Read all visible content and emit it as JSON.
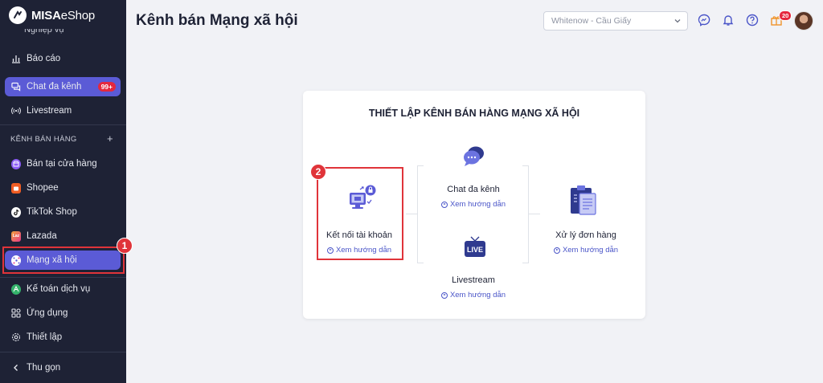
{
  "brand": {
    "name_bold": "MISA",
    "name_light": "eShop"
  },
  "sidebar": {
    "cut_item": "Nghiệp vụ",
    "items": [
      {
        "label": "Báo cáo",
        "icon": "bar-chart-icon"
      },
      {
        "label": "Chat đa kênh",
        "icon": "chat-icon",
        "badge": "99+"
      },
      {
        "label": "Livestream",
        "icon": "broadcast-icon"
      }
    ],
    "section_label": "KÊNH BÁN HÀNG",
    "section_add": "+",
    "channels": [
      {
        "label": "Bán tại cửa hàng",
        "color": "#8b5cf6"
      },
      {
        "label": "Shopee",
        "color": "#f05d23"
      },
      {
        "label": "TikTok Shop",
        "color": "#111111"
      },
      {
        "label": "Lazada",
        "color": "#e53a8a"
      },
      {
        "label": "Mạng xã hội",
        "color": "#ffffff"
      }
    ],
    "bottom_items": [
      {
        "label": "Kế toán dịch vụ",
        "icon": "accounting-icon"
      },
      {
        "label": "Ứng dụng",
        "icon": "apps-icon"
      },
      {
        "label": "Thiết lập",
        "icon": "settings-icon"
      }
    ],
    "collapse_label": "Thu gọn"
  },
  "header": {
    "title": "Kênh bán Mạng xã hội",
    "store_select": "Whitenow - Cầu Giấy",
    "notification_count": "20"
  },
  "card": {
    "title": "THIẾT LẬP KÊNH BÁN HÀNG MẠNG XÃ HỘI",
    "steps": {
      "connect": {
        "label": "Kết nối tài khoản",
        "link": "Xem hướng dẫn"
      },
      "chat": {
        "label": "Chat đa kênh",
        "link": "Xem hướng dẫn"
      },
      "livestream": {
        "label": "Livestream",
        "link": "Xem hướng dẫn",
        "icon_text": "LIVE"
      },
      "orders": {
        "label": "Xử lý đơn hàng",
        "link": "Xem hướng dẫn"
      }
    }
  },
  "annotations": {
    "marker1": "1",
    "marker2": "2"
  },
  "colors": {
    "sidebar_bg": "#1e2235",
    "accent": "#5b5bd6",
    "highlight": "#e0343a",
    "link": "#4a55c8"
  }
}
